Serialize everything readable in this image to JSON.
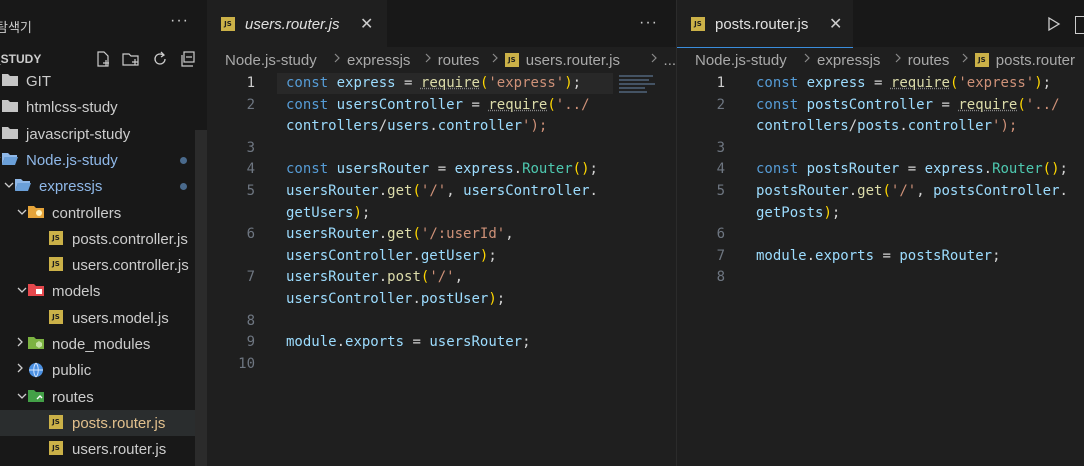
{
  "sidebar": {
    "title": "탐색기",
    "more": "···",
    "section": "_STUDY",
    "items": [
      {
        "label": "GIT",
        "depth": 0,
        "kind": "folder"
      },
      {
        "label": "htmlcss-study",
        "depth": 0,
        "kind": "folder"
      },
      {
        "label": "javascript-study",
        "depth": 0,
        "kind": "folder"
      },
      {
        "label": "Node.js-study",
        "depth": 0,
        "kind": "folder-open",
        "color": "blue",
        "dot": true
      },
      {
        "label": "expressjs",
        "depth": 1,
        "kind": "folder-open",
        "color": "blue",
        "dot": true
      },
      {
        "label": "controllers",
        "depth": 2,
        "kind": "folder-controllers"
      },
      {
        "label": "posts.controller.js",
        "depth": 3,
        "kind": "js"
      },
      {
        "label": "users.controller.js",
        "depth": 3,
        "kind": "js"
      },
      {
        "label": "models",
        "depth": 2,
        "kind": "folder-models"
      },
      {
        "label": "users.model.js",
        "depth": 3,
        "kind": "js"
      },
      {
        "label": "node_modules",
        "depth": 2,
        "kind": "folder-node"
      },
      {
        "label": "public",
        "depth": 2,
        "kind": "folder-public"
      },
      {
        "label": "routes",
        "depth": 2,
        "kind": "folder-routes"
      },
      {
        "label": "posts.router.js",
        "depth": 3,
        "kind": "js",
        "selected": true,
        "color": "yellow"
      },
      {
        "label": "users.router.js",
        "depth": 3,
        "kind": "js"
      }
    ]
  },
  "left_editor": {
    "tab_label": "users.router.js",
    "tab_close": "✕",
    "tab_more": "···",
    "breadcrumbs": [
      "Node.js-study",
      "expressjs",
      "routes",
      "users.router.js",
      "..."
    ],
    "lines": [
      {
        "n": "1",
        "text": "const express = require('express');"
      },
      {
        "n": "2",
        "text": "const usersController = require('../"
      },
      {
        "n": "",
        "text": "controllers/users.controller');"
      },
      {
        "n": "3",
        "text": ""
      },
      {
        "n": "4",
        "text": "const usersRouter = express.Router();"
      },
      {
        "n": "5",
        "text": "usersRouter.get('/', usersController."
      },
      {
        "n": "",
        "text": "getUsers);"
      },
      {
        "n": "6",
        "text": "usersRouter.get('/:userId',"
      },
      {
        "n": "",
        "text": "usersController.getUser);"
      },
      {
        "n": "7",
        "text": "usersRouter.post('/',"
      },
      {
        "n": "",
        "text": "usersController.postUser);"
      },
      {
        "n": "8",
        "text": ""
      },
      {
        "n": "9",
        "text": "module.exports = usersRouter;"
      },
      {
        "n": "10",
        "text": ""
      }
    ]
  },
  "right_editor": {
    "tab_label": "posts.router.js",
    "tab_close": "✕",
    "breadcrumbs": [
      "Node.js-study",
      "expressjs",
      "routes",
      "posts.router"
    ],
    "lines": [
      {
        "n": "1",
        "text": "const express = require('express');"
      },
      {
        "n": "2",
        "text": "const postsController = require('../"
      },
      {
        "n": "",
        "text": "controllers/posts.controller');"
      },
      {
        "n": "3",
        "text": ""
      },
      {
        "n": "4",
        "text": "const postsRouter = express.Router();"
      },
      {
        "n": "5",
        "text": "postsRouter.get('/', postsController."
      },
      {
        "n": "",
        "text": "getPosts);"
      },
      {
        "n": "6",
        "text": ""
      },
      {
        "n": "7",
        "text": "module.exports = postsRouter;"
      },
      {
        "n": "8",
        "text": ""
      }
    ]
  },
  "colors": {
    "keyword": "#569cd6",
    "variable": "#9cdcfe",
    "function": "#dcdcaa",
    "string": "#ce9178",
    "class": "#4ec9b0"
  }
}
